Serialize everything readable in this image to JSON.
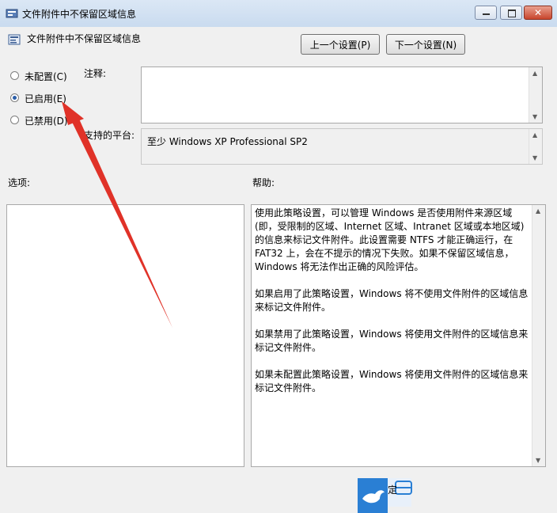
{
  "window": {
    "title": "文件附件中不保留区域信息",
    "minimize": "–",
    "maximize": "□",
    "close": "✕"
  },
  "header": {
    "policy_name": "文件附件中不保留区域信息",
    "prev_button": "上一个设置(P)",
    "next_button": "下一个设置(N)"
  },
  "radios": [
    {
      "label": "未配置(C)",
      "checked": false
    },
    {
      "label": "已启用(E)",
      "checked": true
    },
    {
      "label": "已禁用(D)",
      "checked": false
    }
  ],
  "comment": {
    "label": "注释:",
    "value": ""
  },
  "platform": {
    "label": "支持的平台:",
    "value": "至少 Windows XP Professional SP2"
  },
  "options": {
    "label": "选项:"
  },
  "help": {
    "label": "帮助:",
    "paragraphs": [
      "使用此策略设置，可以管理 Windows 是否使用附件来源区域(即，受限制的区域、Internet 区域、Intranet 区域或本地区域)的信息来标记文件附件。此设置需要 NTFS 才能正确运行，在 FAT32 上，会在不提示的情况下失败。如果不保留区域信息，Windows 将无法作出正确的风险评估。",
      "如果启用了此策略设置，Windows 将不使用文件附件的区域信息来标记文件附件。",
      "如果禁用了此策略设置，Windows 将使用文件附件的区域信息来标记文件附件。",
      "如果未配置此策略设置，Windows 将使用文件附件的区域信息来标记文件附件。"
    ]
  },
  "bottom": {
    "partial_button": "定"
  },
  "colors": {
    "accent_arrow": "#e03228",
    "radio_dot": "#2b5ea8"
  }
}
